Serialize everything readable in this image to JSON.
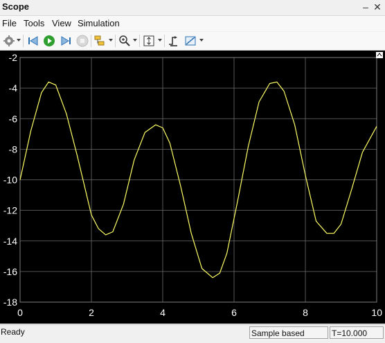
{
  "window": {
    "title": "Scope"
  },
  "menu": [
    "File",
    "Tools",
    "View",
    "Simulation"
  ],
  "toolbar": [
    {
      "icon": "gear-icon"
    },
    {
      "icon": "step-back-icon"
    },
    {
      "icon": "run-icon"
    },
    {
      "icon": "step-forward-icon"
    },
    {
      "icon": "stop-icon"
    },
    {
      "icon": "highlight-icon"
    },
    {
      "icon": "zoom-icon"
    },
    {
      "icon": "autoscale-icon"
    },
    {
      "icon": "triggers-icon"
    },
    {
      "icon": "measurements-icon"
    }
  ],
  "status": {
    "ready": "Ready",
    "mode": "Sample based",
    "time": "T=10.000"
  },
  "colors": {
    "plot_bg": "#000000",
    "grid": "#6e6e6e",
    "trace": "#ffff66"
  },
  "chart_data": {
    "type": "line",
    "title": "",
    "xlabel": "",
    "ylabel": "",
    "xlim": [
      0,
      10
    ],
    "ylim": [
      -18,
      -2
    ],
    "xticks": [
      "0",
      "2",
      "4",
      "6",
      "8",
      "10"
    ],
    "yticks": [
      "-2",
      "-4",
      "-6",
      "-8",
      "-10",
      "-12",
      "-14",
      "-16",
      "-18"
    ],
    "grid": true,
    "series": [
      {
        "x": [
          0,
          0.3,
          0.6,
          0.8,
          1.0,
          1.3,
          1.6,
          2.0,
          2.2,
          2.4,
          2.6,
          2.9,
          3.2,
          3.5,
          3.8,
          4.0,
          4.2,
          4.5,
          4.8,
          5.1,
          5.4,
          5.6,
          5.8,
          6.1,
          6.4,
          6.7,
          7.0,
          7.2,
          7.4,
          7.7,
          8.0,
          8.3,
          8.6,
          8.8,
          9.0,
          9.3,
          9.6,
          10.0
        ],
        "y": [
          -10,
          -6.8,
          -4.3,
          -3.6,
          -3.8,
          -5.7,
          -8.4,
          -12.3,
          -13.2,
          -13.6,
          -13.4,
          -11.6,
          -8.7,
          -6.9,
          -6.4,
          -6.6,
          -7.6,
          -10.4,
          -13.5,
          -15.8,
          -16.4,
          -16.1,
          -14.8,
          -11.4,
          -7.8,
          -4.9,
          -3.7,
          -3.6,
          -4.2,
          -6.4,
          -9.7,
          -12.7,
          -13.5,
          -13.5,
          -12.9,
          -10.6,
          -8.2,
          -6.5
        ]
      }
    ]
  }
}
